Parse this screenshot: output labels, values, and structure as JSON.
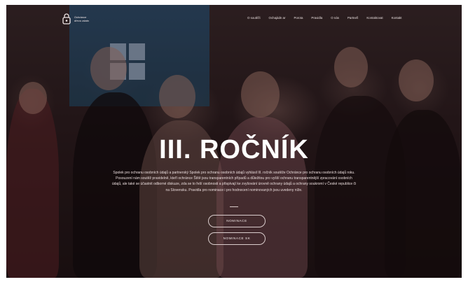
{
  "brand": {
    "line1": "Ochránce",
    "line2": "dřevo zdatn"
  },
  "nav": {
    "items": [
      "O soutěži",
      "Ochajádn ar",
      "Porota",
      "Pravidla",
      "O nás",
      "Partneři",
      "Kontaktovat",
      "Kontakt"
    ]
  },
  "hero": {
    "title": "III. ROČNÍK",
    "description": "Spolek pro ochranu osobních údajů a partnerský Spolek pro ochranu osobních údajů vyhlásil III. ročník soutěže Ochránce pro ochranu osobních údajů roku. Posouzení nám soutěž pravidelně, kteří ochránce Štítě jsou transparentních případů a důležitou pro vyšší ochranu transparentnější zpracování osobních údajů, ale také se účastnit odborné diskuze, zda se to řeší osobnosti a přispívají ke zvyšování úrovně ochrany údajů a ochrany soukromí v České republice či na Slovensku. Pravidla pro nominace i pro hodnocení nominovaných jsou uvedeny níže.",
    "button1": "NOMINACE",
    "button2": "NOMINACE SK"
  },
  "colors": {
    "overlay": "#1d1214",
    "screen": "#2a5f8a",
    "text": "#ffffff"
  }
}
